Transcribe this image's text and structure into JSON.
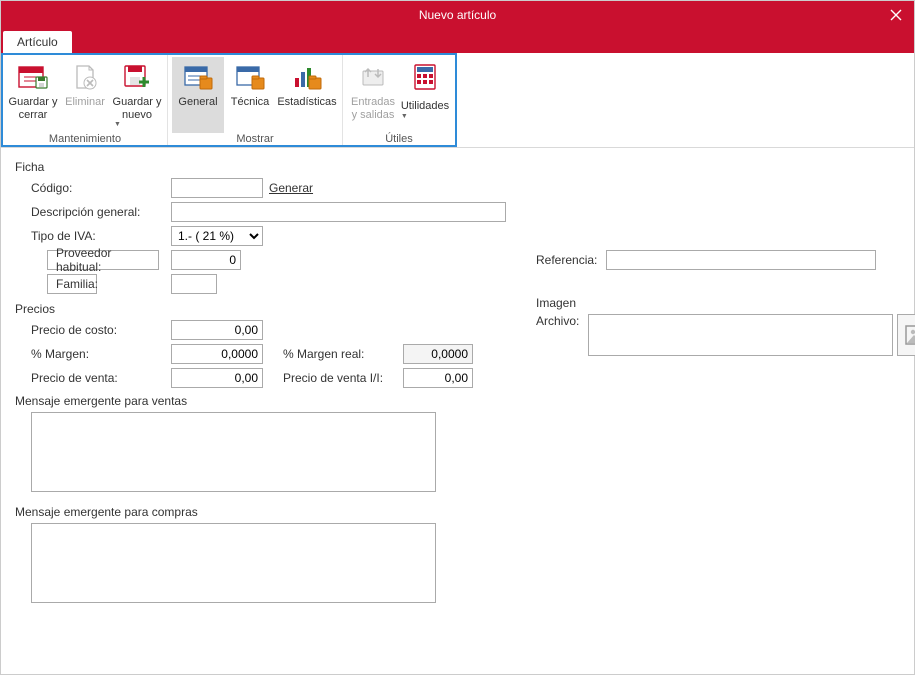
{
  "window": {
    "title": "Nuevo artículo"
  },
  "tabs": {
    "articulo": "Artículo"
  },
  "ribbon": {
    "mantenimiento": {
      "label": "Mantenimiento",
      "guardar_cerrar": "Guardar y cerrar",
      "eliminar": "Eliminar",
      "guardar_nuevo": "Guardar y nuevo"
    },
    "mostrar": {
      "label": "Mostrar",
      "general": "General",
      "tecnica": "Técnica",
      "estadisticas": "Estadísticas"
    },
    "utiles": {
      "label": "Útiles",
      "entradas_salidas": "Entradas y salidas",
      "utilidades": "Utilidades"
    }
  },
  "ficha": {
    "section": "Ficha",
    "codigo_label": "Código:",
    "codigo_value": "",
    "generar": "Generar",
    "descripcion_label": "Descripción general:",
    "descripcion_value": "",
    "tipo_iva_label": "Tipo de IVA:",
    "tipo_iva_value": "1.- ( 21 %)",
    "proveedor_btn": "Proveedor habitual:",
    "proveedor_value": "0",
    "familia_btn": "Familia:",
    "familia_value": "",
    "referencia_label": "Referencia:",
    "referencia_value": ""
  },
  "precios": {
    "section": "Precios",
    "costo_label": "Precio de costo:",
    "costo_value": "0,00",
    "margen_label": "% Margen:",
    "margen_value": "0,0000",
    "venta_label": "Precio de venta:",
    "venta_value": "0,00",
    "margen_real_label": "% Margen real:",
    "margen_real_value": "0,0000",
    "venta_ii_label": "Precio de venta I/I:",
    "venta_ii_value": "0,00"
  },
  "imagen": {
    "section": "Imagen",
    "archivo_label": "Archivo:"
  },
  "mensajes": {
    "ventas_label": "Mensaje emergente para ventas",
    "ventas_value": "",
    "compras_label": "Mensaje emergente para compras",
    "compras_value": ""
  }
}
